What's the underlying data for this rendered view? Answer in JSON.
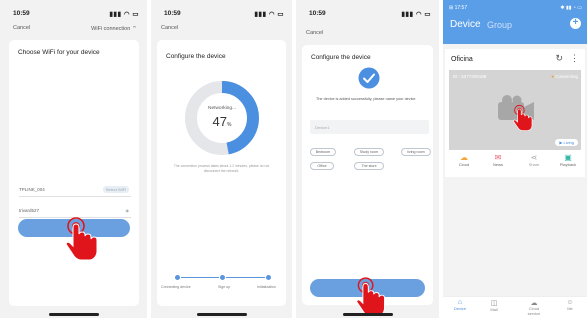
{
  "screen1": {
    "time": "10:59",
    "cancel": "Cancel",
    "wifi_connection": "WiFi connection",
    "heading": "Choose WiFi for your device",
    "wifi_name": "TPLINK_004",
    "wifi_switch": "Select WiFi",
    "password": "trivard527"
  },
  "screen2": {
    "time": "10:59",
    "cancel": "Cancel",
    "heading": "Configure the device",
    "networking": "Networking...",
    "percent": "47",
    "percent_unit": "%",
    "percent_value": 0.47,
    "hint": "The connection process takes about 1-2 minutes, please do not disconnect the network.",
    "steps": [
      "Connecting device",
      "Sign up",
      "Initialization"
    ]
  },
  "screen3": {
    "time": "10:59",
    "cancel": "Cancel",
    "heading": "Configure the device",
    "success_message": "The device is added successfully, please name your device",
    "name_placeholder": "Device1",
    "tags": [
      "Bedroom",
      "Study room",
      "living room",
      "Office",
      "The store"
    ]
  },
  "screen4": {
    "time": "17:57",
    "tabs": [
      "Device",
      "Group"
    ],
    "add_symbol": "+",
    "device_name": "Oficina",
    "device_id": "ID : 5277206188",
    "connecting": "Connecting",
    "live": "Living",
    "actions": [
      "Cloud",
      "News",
      "Share",
      "Playback"
    ],
    "bottom_nav": [
      "Device",
      "Mall",
      "Cloud service",
      "Me"
    ]
  },
  "colors": {
    "accent": "#4a8fe0",
    "progress_track": "#e4e6ea",
    "button": "#6aa0e0",
    "hand": "#e0151b",
    "topbar": "#5a9ee8"
  }
}
